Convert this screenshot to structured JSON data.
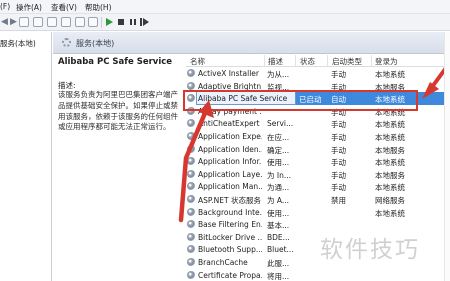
{
  "menubar": {
    "items": [
      "(F)",
      "操作(A)",
      "查看(V)",
      "帮助(H)"
    ]
  },
  "tree": {
    "root_label": "服务(本地)"
  },
  "header": {
    "title": "服务(本地)"
  },
  "details": {
    "service_name": "Alibaba PC Safe Service",
    "description_label": "描述:",
    "description_text": "该服务负责为阿里巴巴集团客户端产品提供基础安全保护。如果停止或禁用该服务，依赖于该服务的任何组件或应用程序都可能无法正常运行。"
  },
  "columns": [
    "名称",
    "描述",
    "状态",
    "启动类型",
    "登录为"
  ],
  "services": [
    {
      "name": "ActiveX Installer ...",
      "desc": "为从...",
      "status": "",
      "startup": "手动",
      "logon": "本地系统"
    },
    {
      "name": "Adaptive Brightn...",
      "desc": "监视...",
      "status": "",
      "startup": "手动",
      "logon": "本地服务"
    },
    {
      "name": "Alibaba PC Safe Service",
      "desc": "",
      "status": "已启动",
      "startup": "自动",
      "logon": "本地系统",
      "selected": true
    },
    {
      "name": "Alipay payment ...",
      "desc": "",
      "status": "",
      "startup": "手动",
      "logon": "本地系统"
    },
    {
      "name": "AntiCheatExpert ...",
      "desc": "Servi...",
      "status": "",
      "startup": "手动",
      "logon": "本地系统"
    },
    {
      "name": "Application Expe...",
      "desc": "在应...",
      "status": "",
      "startup": "手动",
      "logon": "本地系统"
    },
    {
      "name": "Application Iden...",
      "desc": "确定...",
      "status": "",
      "startup": "手动",
      "logon": "本地服务"
    },
    {
      "name": "Application Infor...",
      "desc": "使用...",
      "status": "",
      "startup": "手动",
      "logon": "本地系统"
    },
    {
      "name": "Application Laye...",
      "desc": "为 In...",
      "status": "",
      "startup": "手动",
      "logon": "本地服务"
    },
    {
      "name": "Application Man...",
      "desc": "为通...",
      "status": "",
      "startup": "手动",
      "logon": "本地系统"
    },
    {
      "name": "ASP.NET 状态服务",
      "desc": "为 A...",
      "status": "",
      "startup": "禁用",
      "logon": "网络服务"
    },
    {
      "name": "Background Inte...",
      "desc": "使用...",
      "status": "",
      "startup": "",
      "logon": "本地系统"
    },
    {
      "name": "Base Filtering En...",
      "desc": "基本...",
      "status": "",
      "startup": "",
      "logon": ""
    },
    {
      "name": "BitLocker Drive ...",
      "desc": "BDE...",
      "status": "",
      "startup": "",
      "logon": ""
    },
    {
      "name": "Bluetooth Supp...",
      "desc": "Bluet...",
      "status": "",
      "startup": "",
      "logon": ""
    },
    {
      "name": "BranchCache",
      "desc": "此服...",
      "status": "",
      "startup": "",
      "logon": ""
    },
    {
      "name": "Certificate Propa...",
      "desc": "将用...",
      "status": "",
      "startup": "",
      "logon": ""
    }
  ],
  "watermark": "软件技巧",
  "colors": {
    "selection": "#3e89dc",
    "annotation": "#d6382f"
  }
}
